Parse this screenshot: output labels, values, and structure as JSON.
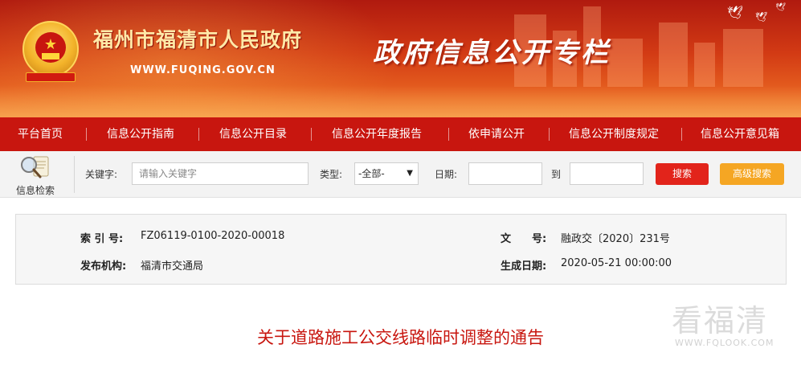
{
  "banner": {
    "site_title": "福州市福清市人民政府",
    "site_url": "WWW.FUQING.GOV.CN",
    "slogan": "政府信息公开专栏",
    "emblem_icon": "national-emblem-icon"
  },
  "nav": {
    "items": [
      {
        "label": "平台首页"
      },
      {
        "label": "信息公开指南"
      },
      {
        "label": "信息公开目录"
      },
      {
        "label": "信息公开年度报告"
      },
      {
        "label": "依申请公开"
      },
      {
        "label": "信息公开制度规定"
      },
      {
        "label": "信息公开意见箱"
      }
    ]
  },
  "search": {
    "icon_label": "信息检索",
    "icon": "magnifier-document-icon",
    "keyword_label": "关键字:",
    "keyword_placeholder": "请输入关键字",
    "type_label": "类型:",
    "type_selected": "-全部-",
    "date_label": "日期:",
    "date_to_label": "到",
    "search_button": "搜索",
    "advanced_button": "高级搜索"
  },
  "info": {
    "index_label": "索 引 号:",
    "index_value": "FZ06119-0100-2020-00018",
    "doc_no_label": "文　　号:",
    "doc_no_value": "融政交〔2020〕231号",
    "publisher_label": "发布机构:",
    "publisher_value": "福清市交通局",
    "date_label": "生成日期:",
    "date_value": "2020-05-21 00:00:00"
  },
  "article": {
    "title": "关于道路施工公交线路临时调整的通告"
  },
  "watermark": {
    "main": "看福清",
    "url": "WWW.FQLOOK.COM"
  },
  "colors": {
    "brand_red": "#c8160f",
    "search_button": "#e2241b",
    "advanced_button": "#f5a623",
    "title_red": "#c8160f"
  }
}
